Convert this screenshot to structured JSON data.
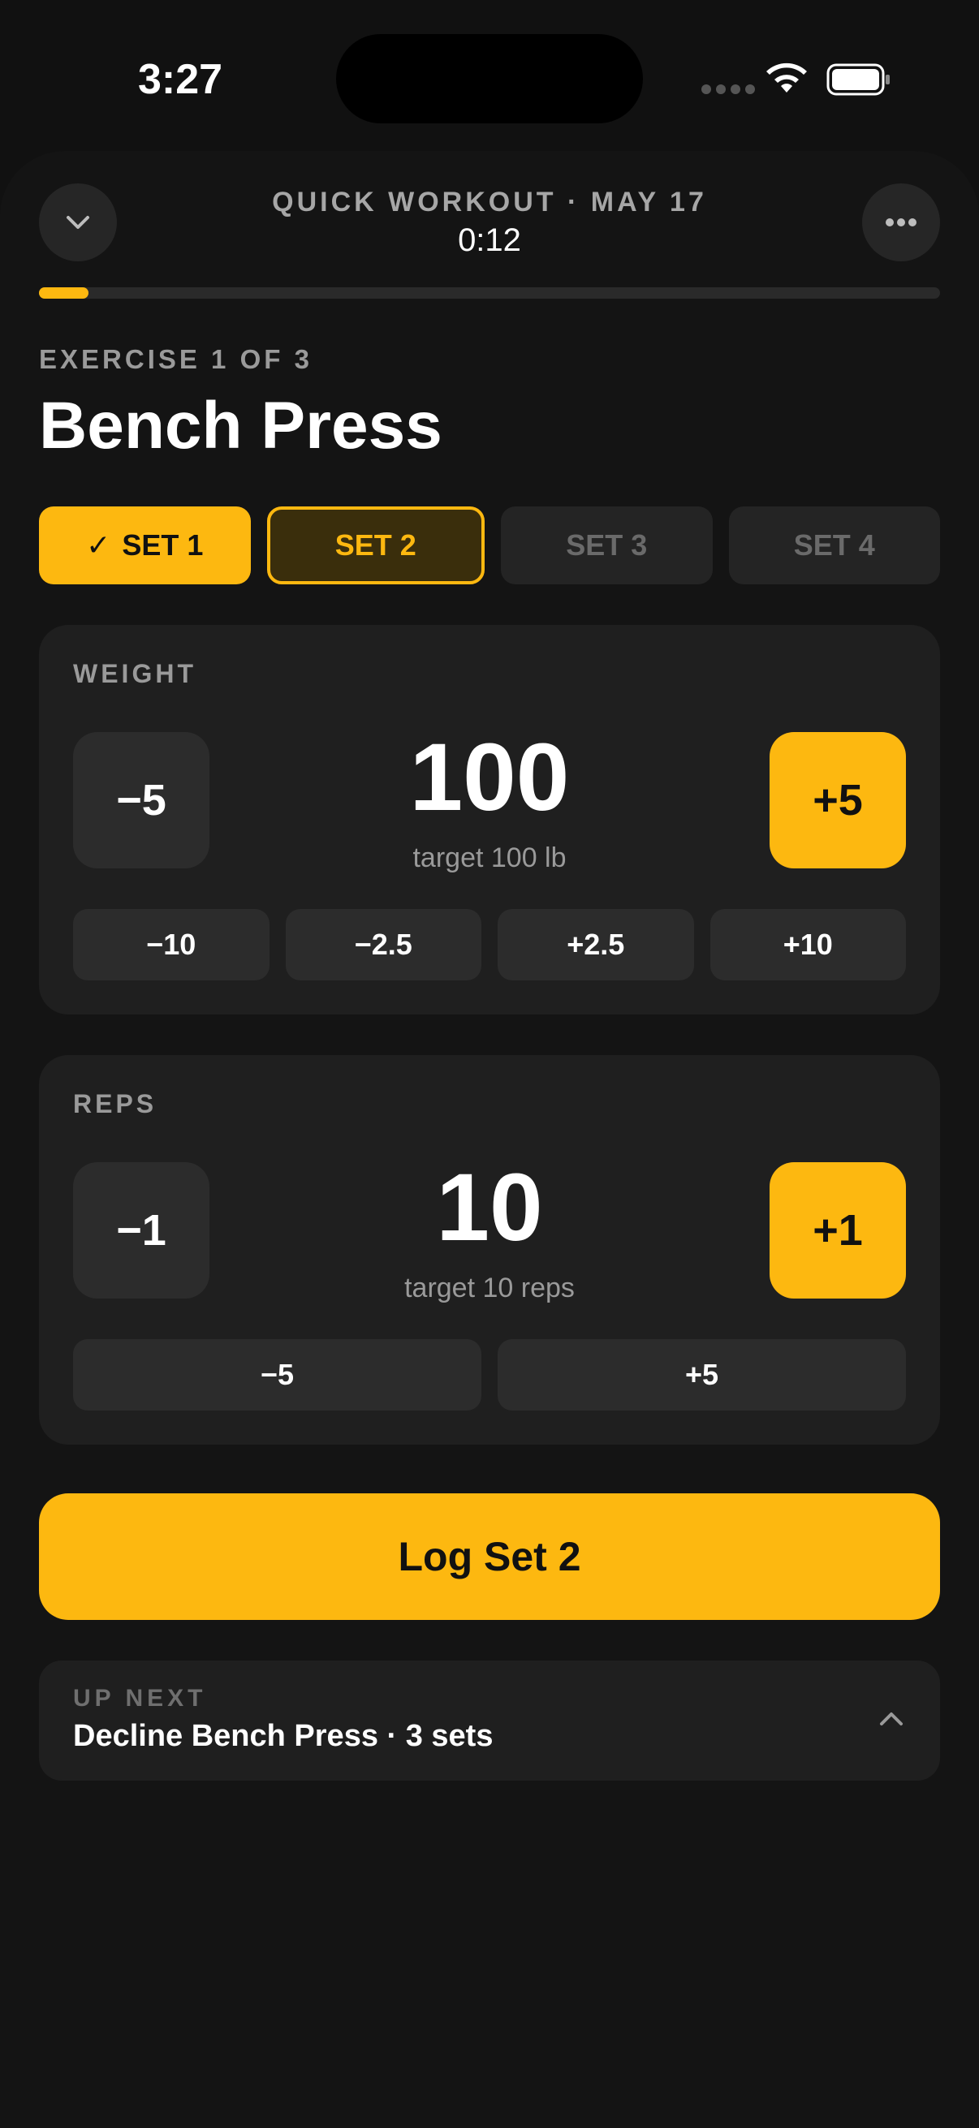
{
  "status_bar": {
    "time": "3:27"
  },
  "header": {
    "title": "QUICK WORKOUT · MAY 17",
    "timer": "0:12",
    "progress_fraction": 0.055
  },
  "exercise": {
    "label": "EXERCISE 1 OF 3",
    "name": "Bench Press"
  },
  "sets": [
    {
      "label": "SET 1",
      "state": "done",
      "check": "✓"
    },
    {
      "label": "SET 2",
      "state": "active"
    },
    {
      "label": "SET 3",
      "state": "pending"
    },
    {
      "label": "SET 4",
      "state": "pending"
    }
  ],
  "weight": {
    "label": "WEIGHT",
    "value": "100",
    "target": "target 100 lb",
    "minus_label": "−5",
    "plus_label": "+5",
    "quick": [
      "−10",
      "−2.5",
      "+2.5",
      "+10"
    ]
  },
  "reps": {
    "label": "REPS",
    "value": "10",
    "target": "target 10 reps",
    "minus_label": "−1",
    "plus_label": "+1",
    "quick": [
      "−5",
      "+5"
    ]
  },
  "log_button": "Log Set 2",
  "up_next": {
    "label": "UP NEXT",
    "name": "Decline Bench Press · 3 sets"
  },
  "colors": {
    "accent": "#FDB810",
    "background": "#111111",
    "card": "#1f1f1f"
  },
  "icons": {
    "collapse": "chevron-down-icon",
    "more": "more-icon",
    "expand": "chevron-up-icon",
    "check": "check-icon"
  }
}
